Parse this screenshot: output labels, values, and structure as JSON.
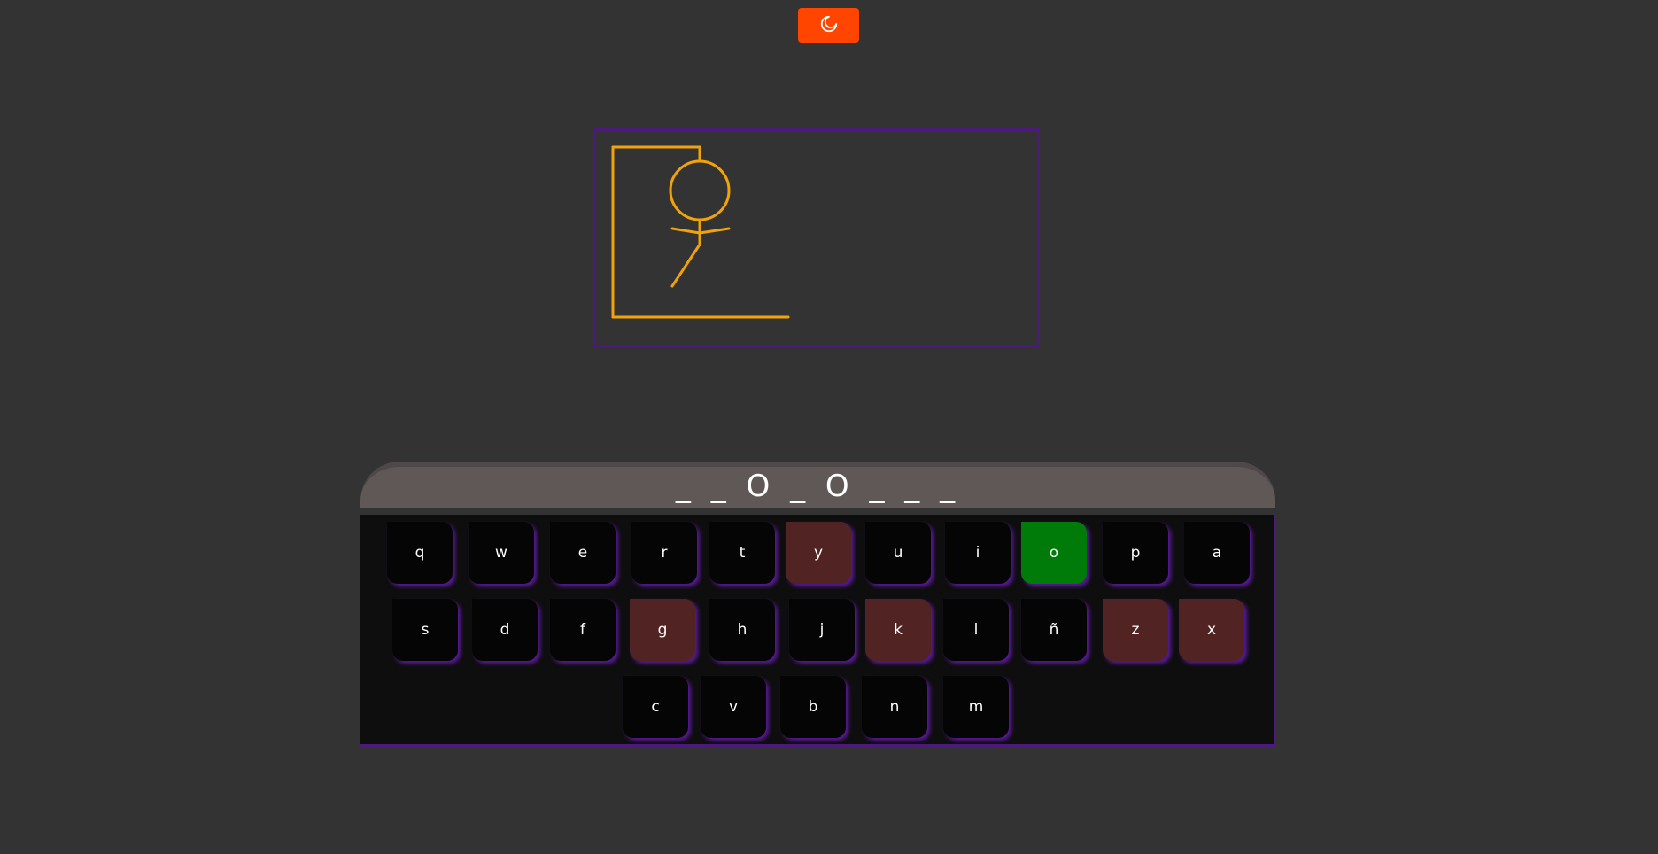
{
  "theme_toggle": {
    "icon": "moon-icon",
    "color": "#ff4500"
  },
  "word": {
    "display": "_ _ O _ O _ _ _"
  },
  "keyboard": {
    "rows": [
      [
        {
          "letter": "q",
          "state": "unused"
        },
        {
          "letter": "w",
          "state": "unused"
        },
        {
          "letter": "e",
          "state": "unused"
        },
        {
          "letter": "r",
          "state": "unused"
        },
        {
          "letter": "t",
          "state": "unused"
        },
        {
          "letter": "y",
          "state": "wrong"
        },
        {
          "letter": "u",
          "state": "unused"
        },
        {
          "letter": "i",
          "state": "unused"
        },
        {
          "letter": "o",
          "state": "correct"
        },
        {
          "letter": "p",
          "state": "unused"
        },
        {
          "letter": "a",
          "state": "unused"
        }
      ],
      [
        {
          "letter": "s",
          "state": "unused"
        },
        {
          "letter": "d",
          "state": "unused"
        },
        {
          "letter": "f",
          "state": "unused"
        },
        {
          "letter": "g",
          "state": "wrong"
        },
        {
          "letter": "h",
          "state": "unused"
        },
        {
          "letter": "j",
          "state": "unused"
        },
        {
          "letter": "k",
          "state": "wrong"
        },
        {
          "letter": "l",
          "state": "unused"
        },
        {
          "letter": "ñ",
          "state": "unused"
        },
        {
          "letter": "z",
          "state": "wrong"
        },
        {
          "letter": "x",
          "state": "wrong"
        }
      ],
      [
        {
          "letter": "c",
          "state": "unused"
        },
        {
          "letter": "v",
          "state": "unused"
        },
        {
          "letter": "b",
          "state": "unused"
        },
        {
          "letter": "n",
          "state": "unused"
        },
        {
          "letter": "m",
          "state": "unused"
        }
      ]
    ]
  },
  "hangman": {
    "wrong_guesses": 5,
    "parts_drawn": [
      "gallows",
      "head",
      "body",
      "arms",
      "left-leg"
    ],
    "stroke_color": "#f0a30a",
    "frame_color": "#4b1a7a"
  },
  "colors": {
    "background": "#333333",
    "key_default": "#050505",
    "key_wrong": "#522323",
    "key_correct": "#007a08",
    "key_shadow": "#5a1a9a"
  }
}
